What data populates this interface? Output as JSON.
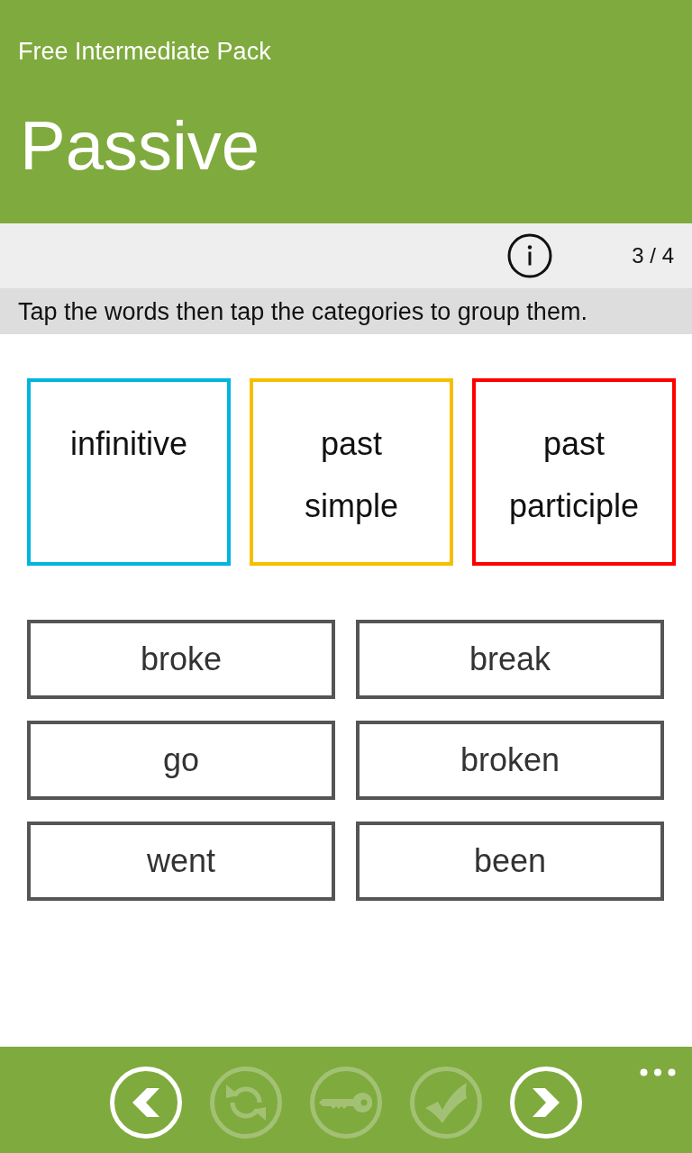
{
  "header": {
    "subtitle": "Free Intermediate Pack",
    "title": "Passive"
  },
  "toolbar": {
    "counter": "3 / 4"
  },
  "instruction": "Tap the words then tap the categories to group them.",
  "categories": [
    {
      "label": "infinitive",
      "color": "#00b4e0"
    },
    {
      "label": "past simple",
      "color": "#f7be00"
    },
    {
      "label": "past participle",
      "color": "#ff0000"
    }
  ],
  "words": [
    "broke",
    "break",
    "go",
    "broken",
    "went",
    "been"
  ],
  "app_bar": {
    "buttons": [
      {
        "kind": "back",
        "disabled": false
      },
      {
        "kind": "refresh",
        "disabled": true
      },
      {
        "kind": "key",
        "disabled": true
      },
      {
        "kind": "check",
        "disabled": true
      },
      {
        "kind": "forward",
        "disabled": false
      }
    ]
  }
}
